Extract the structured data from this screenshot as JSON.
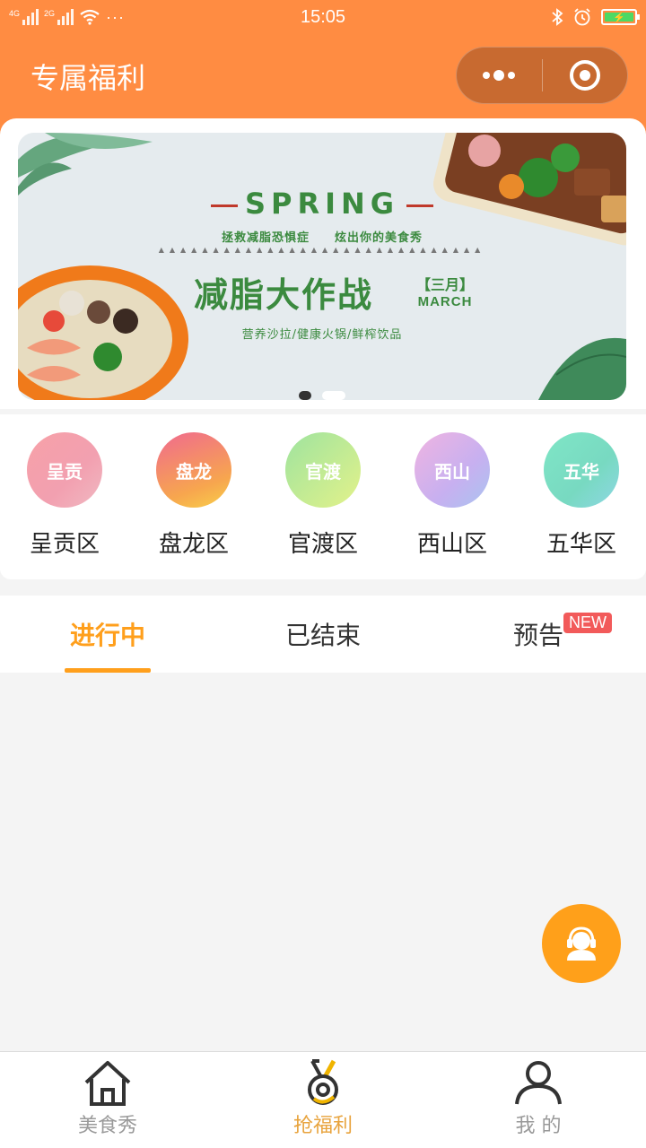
{
  "status_bar": {
    "signal1_label": "4G",
    "signal2_label": "2G",
    "time": "15:05",
    "more": "···"
  },
  "nav": {
    "title": "专属福利"
  },
  "banner": {
    "spring": "SPRING",
    "tagline_left": "拯救减脂恐惧症",
    "tagline_right": "炫出你的美食秀",
    "headline": "减脂大作战",
    "month_cn": "【三月】",
    "month_en": "MARCH",
    "subline": "营养沙拉/健康火锅/鲜榨饮品",
    "active_slide": 1,
    "total_slides": 2
  },
  "districts": [
    {
      "badge": "呈贡",
      "name": "呈贡区"
    },
    {
      "badge": "盘龙",
      "name": "盘龙区"
    },
    {
      "badge": "官渡",
      "name": "官渡区"
    },
    {
      "badge": "西山",
      "name": "西山区"
    },
    {
      "badge": "五华",
      "name": "五华区"
    }
  ],
  "tabs": [
    {
      "label": "进行中",
      "active": true
    },
    {
      "label": "已结束",
      "active": false
    },
    {
      "label": "预告",
      "active": false,
      "badge": "NEW"
    }
  ],
  "fab": {
    "icon": "customer-service-icon"
  },
  "tabbar": [
    {
      "label": "美食秀",
      "icon": "home-icon",
      "active": false
    },
    {
      "label": "抢福利",
      "icon": "medal-icon",
      "active": true
    },
    {
      "label": "我 的",
      "icon": "user-icon",
      "active": false
    }
  ],
  "colors": {
    "primary": "#ff8c42",
    "accent": "#ff9f1c",
    "badge_red": "#f25a5a"
  }
}
